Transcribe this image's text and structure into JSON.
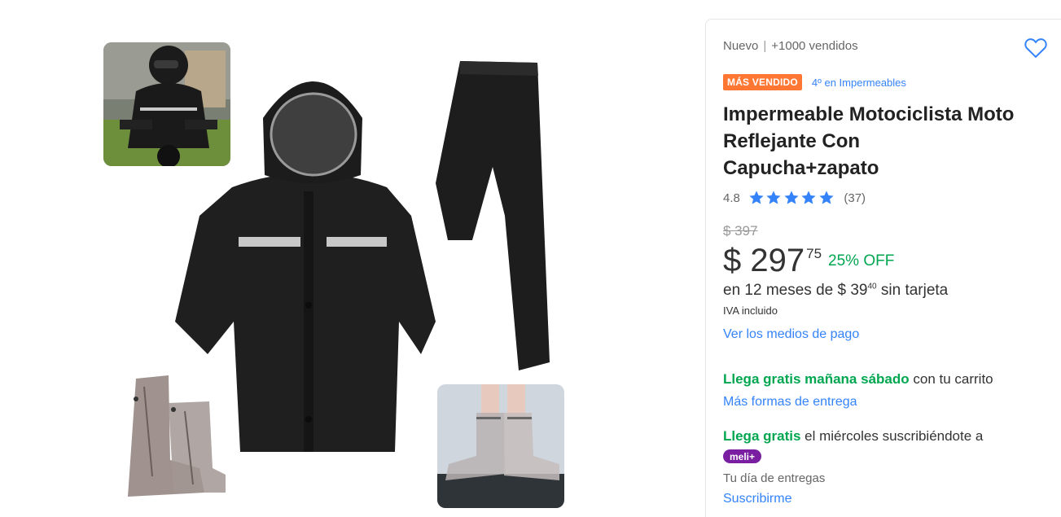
{
  "product": {
    "condition": "Nuevo",
    "separator": "|",
    "sold": "+1000 vendidos",
    "badge": "MÁS VENDIDO",
    "rank": "4º en Impermeables",
    "title": "Impermeable Motociclista Moto Reflejante Con Capucha+zapato",
    "rating_value": "4.8",
    "rating_stars": 4.8,
    "rating_count": "(37)",
    "old_price": "$ 397",
    "price": "$ 297",
    "price_cents": "75",
    "discount": "25% OFF",
    "installments_prefix": "en 12 meses de",
    "installments_amount": "$ 39",
    "installments_cents": "40",
    "installments_suffix": "sin tarjeta",
    "tax_note": "IVA incluido",
    "payment_link": "Ver los medios de pago"
  },
  "shipping": {
    "primary_highlight": "Llega gratis mañana sábado",
    "primary_rest": "con tu carrito",
    "more_link": "Más formas de entrega",
    "secondary_highlight": "Llega gratis",
    "secondary_rest": "el miércoles suscribiéndote a",
    "meli_badge": "meli+",
    "day_text": "Tu día de entregas",
    "subscribe_link": "Suscribirme"
  },
  "colors": {
    "accent_blue": "#3483fa",
    "green": "#00a650",
    "badge_orange": "#ff7733",
    "meli_purple": "#7a1fa2"
  },
  "icons": [
    "heart-icon",
    "star-icon"
  ]
}
